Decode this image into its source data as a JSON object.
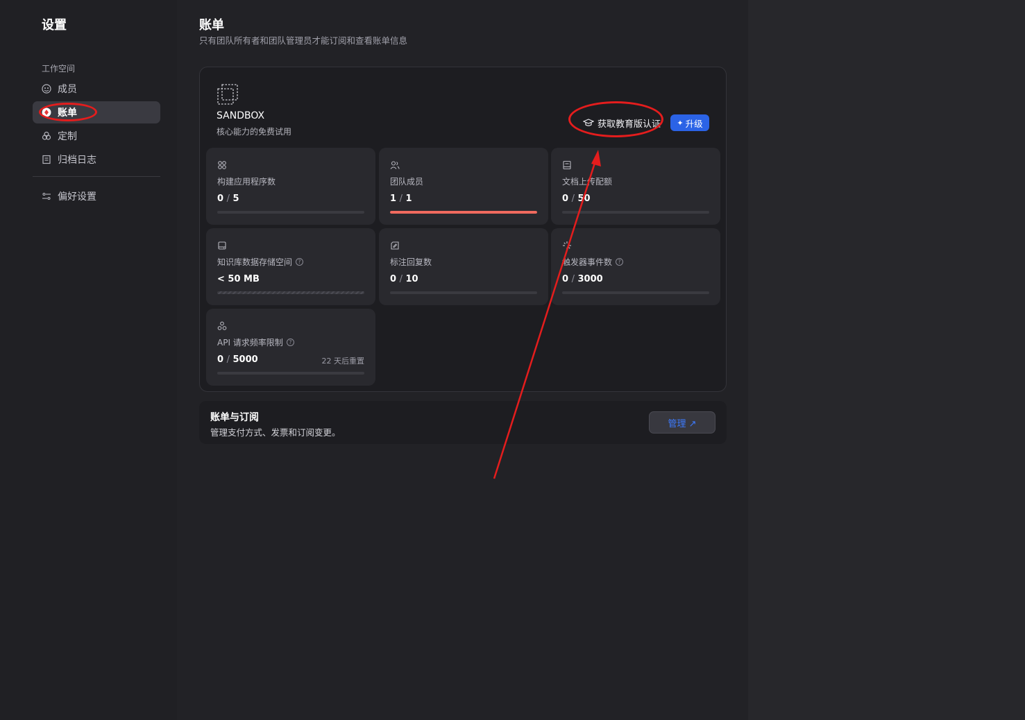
{
  "sidebar": {
    "title": "设置",
    "section_label": "工作空间",
    "items": [
      {
        "label": "成员",
        "icon": "members-icon"
      },
      {
        "label": "账单",
        "icon": "billing-icon",
        "active": true
      },
      {
        "label": "定制",
        "icon": "customize-icon"
      },
      {
        "label": "归档日志",
        "icon": "archive-log-icon"
      }
    ],
    "preferences": {
      "label": "偏好设置",
      "icon": "preferences-icon"
    }
  },
  "main": {
    "title": "账单",
    "subtitle": "只有团队所有者和团队管理员才能订阅和查看账单信息"
  },
  "plan": {
    "name": "SANDBOX",
    "description": "核心能力的免费试用",
    "edu_button": "获取教育版认证",
    "upgrade_button": "升级"
  },
  "stats": [
    {
      "label": "构建应用程序数",
      "used": "0",
      "total": "5",
      "icon": "apps-icon",
      "usage_fraction": 0.0
    },
    {
      "label": "团队成员",
      "used": "1",
      "total": "1",
      "icon": "team-icon",
      "usage_fraction": 1.0
    },
    {
      "label": "文档上传配额",
      "used": "0",
      "total": "50",
      "icon": "document-icon",
      "usage_fraction": 0.0
    },
    {
      "label": "知识库数据存储空间",
      "value": "< 50 MB",
      "icon": "storage-icon",
      "has_help": true,
      "striped": true
    },
    {
      "label": "标注回复数",
      "used": "0",
      "total": "10",
      "icon": "annotation-icon",
      "usage_fraction": 0.0
    },
    {
      "label": "触发器事件数",
      "used": "0",
      "total": "3000",
      "icon": "trigger-icon",
      "has_help": true,
      "usage_fraction": 0.0
    },
    {
      "label": "API 请求频率限制",
      "used": "0",
      "total": "5000",
      "icon": "api-icon",
      "has_help": true,
      "reset": "22 天后重置",
      "usage_fraction": 0.0
    }
  ],
  "billing": {
    "title": "账单与订阅",
    "description": "管理支付方式、发票和订阅变更。",
    "manage_button": "管理 ↗"
  },
  "colors": {
    "accent_blue": "#2b63e6",
    "usage_full_red": "#f06a5e",
    "annotation_red": "#e41d1d"
  }
}
